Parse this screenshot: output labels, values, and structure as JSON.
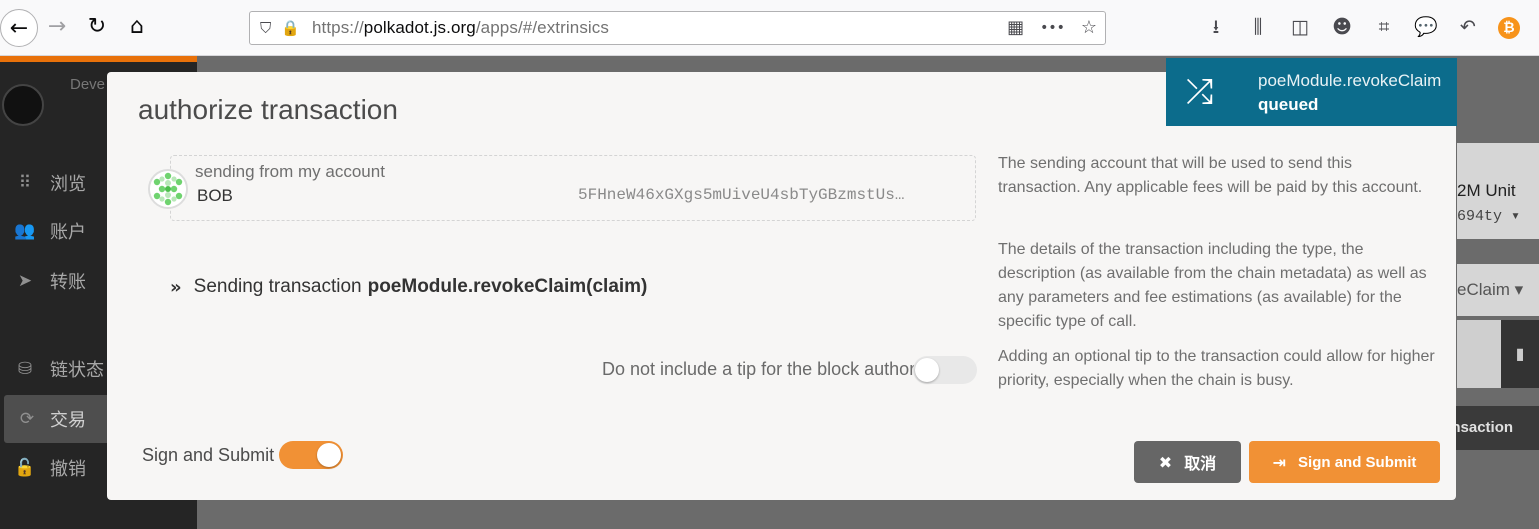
{
  "browser": {
    "url_prefix": "https://",
    "url_host": "polkadot.js.org",
    "url_path": "/apps/#/extrinsics",
    "nav_back_icon": "←",
    "nav_forward_icon": "→",
    "nav_reload_icon": "↻",
    "nav_home_icon": "⌂",
    "more_icon": "•••",
    "star_icon": "☆",
    "qr_icon": "▦",
    "toolbar_icons": [
      "download-icon",
      "library-icon",
      "reader-icon",
      "account-icon",
      "crop-icon",
      "chat-icon",
      "undo-icon",
      "bitcoin-icon"
    ]
  },
  "sidebar": {
    "logo_text": "Deve",
    "items": [
      {
        "icon": "⠿",
        "label": "浏览"
      },
      {
        "icon": "👥",
        "label": "账户"
      },
      {
        "icon": "➤",
        "label": "转账"
      },
      {
        "icon": "⛁",
        "label": "链状态"
      },
      {
        "icon": "⟳",
        "label": "交易"
      },
      {
        "icon": "🔓",
        "label": "撤销"
      }
    ]
  },
  "background": {
    "unit": "2M Unit",
    "addr": "694ty ▾",
    "claim": "eClaim ▾",
    "doc_icon": "▮",
    "tx_button": "ansaction"
  },
  "modal": {
    "title": "authorize transaction",
    "account_label": "sending from my account",
    "account_name": "BOB",
    "account_address": "5FHneW46xGXgs5mUiveU4sbTyGBzmstUs…",
    "tx_prefix": "Sending transaction",
    "tx_call": "poeModule.revokeClaim(claim)",
    "tip_label": "Do not include a tip for the block author",
    "sign_label": "Sign and Submit",
    "help_1": "The sending account that will be used to send this transaction. Any applicable fees will be paid by this account.",
    "help_2": "The details of the transaction including the type, the description (as available from the chain metadata) as well as any parameters and fee estimations (as available) for the specific type of call.",
    "help_3": "Adding an optional tip to the transaction could allow for higher priority, especially when the chain is busy.",
    "cancel_label": "取消",
    "submit_label": "Sign and Submit",
    "tip_enabled": false,
    "sign_enabled": true
  },
  "notification": {
    "method": "poeModule.revokeClaim",
    "status": "queued"
  },
  "colors": {
    "accent": "#f19135",
    "notify_bg": "#0c6c8c",
    "sidebar_bg": "#252525"
  }
}
